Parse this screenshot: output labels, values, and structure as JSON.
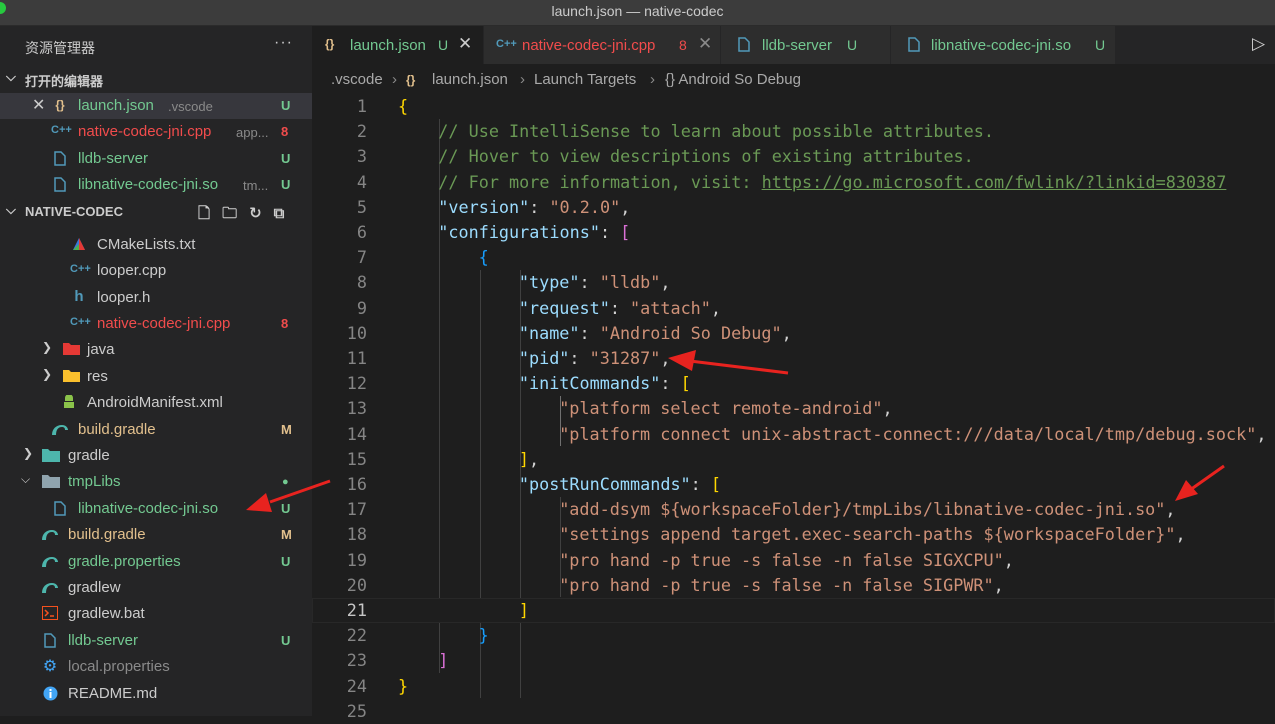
{
  "window": {
    "title": "launch.json — native-codec"
  },
  "sidebar": {
    "header_title": "资源管理器",
    "more_label": "···",
    "open_editors": {
      "title": "打开的编辑器",
      "items": [
        {
          "icon": "{}",
          "name": "launch.json",
          "desc": ".vscode",
          "badge": "U"
        },
        {
          "icon": "C++",
          "name": "native-codec-jni.cpp",
          "desc": "app...",
          "badge": "8"
        },
        {
          "icon": "file",
          "name": "lldb-server",
          "desc": "",
          "badge": "U"
        },
        {
          "icon": "file",
          "name": "libnative-codec-jni.so",
          "desc": "tm...",
          "badge": "U"
        }
      ]
    },
    "project": {
      "title": "NATIVE-CODEC",
      "items": [
        {
          "icon": "cmake",
          "name": "CMakeLists.txt",
          "badge": ""
        },
        {
          "icon": "C++",
          "name": "looper.cpp",
          "badge": ""
        },
        {
          "icon": "h",
          "name": "looper.h",
          "badge": ""
        },
        {
          "icon": "C++",
          "name": "native-codec-jni.cpp",
          "badge": "8"
        },
        {
          "icon": "folder-java",
          "name": "java",
          "badge": ""
        },
        {
          "icon": "folder-res",
          "name": "res",
          "badge": ""
        },
        {
          "icon": "android",
          "name": "AndroidManifest.xml",
          "badge": ""
        },
        {
          "icon": "gradle",
          "name": "build.gradle",
          "badge": "M"
        },
        {
          "icon": "folder-gradle",
          "name": "gradle",
          "badge": ""
        },
        {
          "icon": "folder",
          "name": "tmpLibs",
          "badge": "●"
        },
        {
          "icon": "file",
          "name": "libnative-codec-jni.so",
          "badge": "U"
        },
        {
          "icon": "gradle",
          "name": "build.gradle",
          "badge": "M"
        },
        {
          "icon": "gradle",
          "name": "gradle.properties",
          "badge": "U"
        },
        {
          "icon": "gradle",
          "name": "gradlew",
          "badge": ""
        },
        {
          "icon": "terminal",
          "name": "gradlew.bat",
          "badge": ""
        },
        {
          "icon": "file",
          "name": "lldb-server",
          "badge": "U"
        },
        {
          "icon": "gear",
          "name": "local.properties",
          "badge": ""
        },
        {
          "icon": "info",
          "name": "README.md",
          "badge": ""
        }
      ]
    }
  },
  "tabs": [
    {
      "icon": "{}",
      "label": "launch.json",
      "badge": "U",
      "close": "✕"
    },
    {
      "icon": "C++",
      "label": "native-codec-jni.cpp",
      "badge": "8",
      "close": "✕"
    },
    {
      "icon": "file",
      "label": "lldb-server",
      "badge": "U",
      "close": ""
    },
    {
      "icon": "file",
      "label": "libnative-codec-jni.so",
      "badge": "U",
      "close": ""
    }
  ],
  "breadcrumb": [
    ".vscode",
    "{}",
    "launch.json",
    "Launch Targets",
    "{} Android So Debug"
  ],
  "editor": {
    "current_line": 21,
    "lines": [
      {
        "n": "1",
        "tokens": [
          [
            "b1",
            "{"
          ]
        ]
      },
      {
        "n": "2",
        "tokens": [
          [
            "t-com",
            "// Use IntelliSense to learn about possible attributes."
          ]
        ]
      },
      {
        "n": "3",
        "tokens": [
          [
            "t-com",
            "// Hover to view descriptions of existing attributes."
          ]
        ]
      },
      {
        "n": "4",
        "tokens": [
          [
            "t-com",
            "// For more information, visit: "
          ],
          [
            "t-link",
            "https://go.microsoft.com/fwlink/?linkid=830387"
          ]
        ]
      },
      {
        "n": "5",
        "tokens": [
          [
            "t-key",
            "\"version\""
          ],
          [
            "t-p",
            ": "
          ],
          [
            "t-str",
            "\"0.2.0\""
          ],
          [
            "t-p",
            ","
          ]
        ]
      },
      {
        "n": "6",
        "tokens": [
          [
            "t-key",
            "\"configurations\""
          ],
          [
            "t-p",
            ": "
          ],
          [
            "b2",
            "["
          ]
        ]
      },
      {
        "n": "7",
        "tokens": [
          [
            "b3",
            "{"
          ]
        ]
      },
      {
        "n": "8",
        "tokens": [
          [
            "t-key",
            "\"type\""
          ],
          [
            "t-p",
            ": "
          ],
          [
            "t-str",
            "\"lldb\""
          ],
          [
            "t-p",
            ","
          ]
        ]
      },
      {
        "n": "9",
        "tokens": [
          [
            "t-key",
            "\"request\""
          ],
          [
            "t-p",
            ": "
          ],
          [
            "t-str",
            "\"attach\""
          ],
          [
            "t-p",
            ","
          ]
        ]
      },
      {
        "n": "10",
        "tokens": [
          [
            "t-key",
            "\"name\""
          ],
          [
            "t-p",
            ": "
          ],
          [
            "t-str",
            "\"Android So Debug\""
          ],
          [
            "t-p",
            ","
          ]
        ]
      },
      {
        "n": "11",
        "tokens": [
          [
            "t-key",
            "\"pid\""
          ],
          [
            "t-p",
            ": "
          ],
          [
            "t-str",
            "\"31287\""
          ],
          [
            "t-p",
            ","
          ]
        ]
      },
      {
        "n": "12",
        "tokens": [
          [
            "t-key",
            "\"initCommands\""
          ],
          [
            "t-p",
            ": "
          ],
          [
            "b1",
            "["
          ]
        ]
      },
      {
        "n": "13",
        "tokens": [
          [
            "t-str",
            "\"platform select remote-android\""
          ],
          [
            "t-p",
            ","
          ]
        ]
      },
      {
        "n": "14",
        "tokens": [
          [
            "t-str",
            "\"platform connect unix-abstract-connect:///data/local/tmp/debug.sock\""
          ],
          [
            "t-p",
            ","
          ]
        ]
      },
      {
        "n": "15",
        "tokens": [
          [
            "b1",
            "]"
          ],
          [
            "t-p",
            ","
          ]
        ]
      },
      {
        "n": "16",
        "tokens": [
          [
            "t-key",
            "\"postRunCommands\""
          ],
          [
            "t-p",
            ": "
          ],
          [
            "b1",
            "["
          ]
        ]
      },
      {
        "n": "17",
        "tokens": [
          [
            "t-str",
            "\"add-dsym ${workspaceFolder}/tmpLibs/libnative-codec-jni.so\""
          ],
          [
            "t-p",
            ","
          ]
        ]
      },
      {
        "n": "18",
        "tokens": [
          [
            "t-str",
            "\"settings append target.exec-search-paths ${workspaceFolder}\""
          ],
          [
            "t-p",
            ","
          ]
        ]
      },
      {
        "n": "19",
        "tokens": [
          [
            "t-str",
            "\"pro hand -p true -s false -n false SIGXCPU\""
          ],
          [
            "t-p",
            ","
          ]
        ]
      },
      {
        "n": "20",
        "tokens": [
          [
            "t-str",
            "\"pro hand -p true -s false -n false SIGPWR\""
          ],
          [
            "t-p",
            ","
          ]
        ]
      },
      {
        "n": "21",
        "tokens": [
          [
            "b1",
            "]"
          ]
        ]
      },
      {
        "n": "22",
        "tokens": [
          [
            "b3",
            "}"
          ]
        ]
      },
      {
        "n": "23",
        "tokens": [
          [
            "b2",
            "]"
          ]
        ]
      },
      {
        "n": "24",
        "tokens": [
          [
            "b1",
            "}"
          ]
        ]
      },
      {
        "n": "25",
        "tokens": []
      }
    ]
  },
  "colors": {
    "untracked": "#73c991",
    "error": "#f14c4c",
    "modified": "#e2c08d",
    "annotation_arrow": "#e8231f"
  }
}
